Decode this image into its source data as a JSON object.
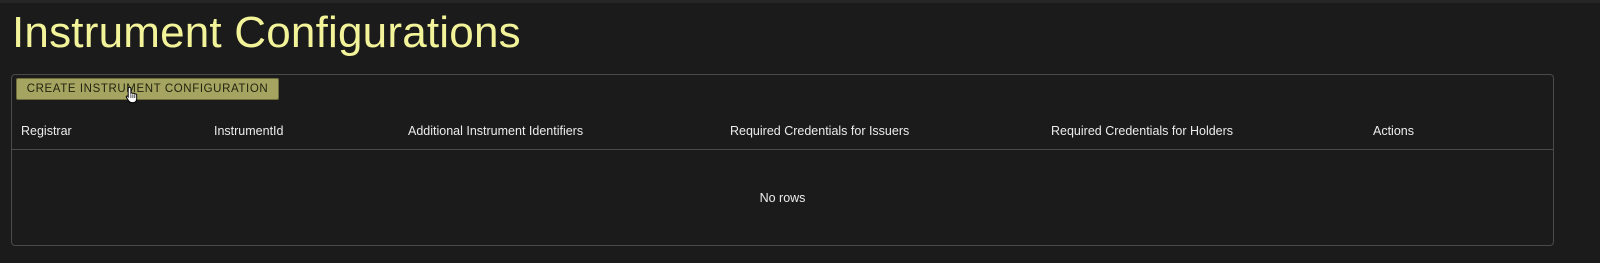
{
  "page": {
    "title": "Instrument Configurations"
  },
  "toolbar": {
    "create_label": "CREATE INSTRUMENT CONFIGURATION"
  },
  "table": {
    "columns": [
      "Registrar",
      "InstrumentId",
      "Additional Instrument Identifiers",
      "Required Credentials for Issuers",
      "Required Credentials for Holders",
      "Actions"
    ],
    "rows": [],
    "empty_text": "No rows"
  },
  "colors": {
    "background": "#1b1b1b",
    "title": "#f3f39a",
    "button": "#a5a561",
    "border": "#4a4a4a",
    "text": "#ececec"
  },
  "icons": {
    "cursor": "hand-pointer-icon"
  }
}
